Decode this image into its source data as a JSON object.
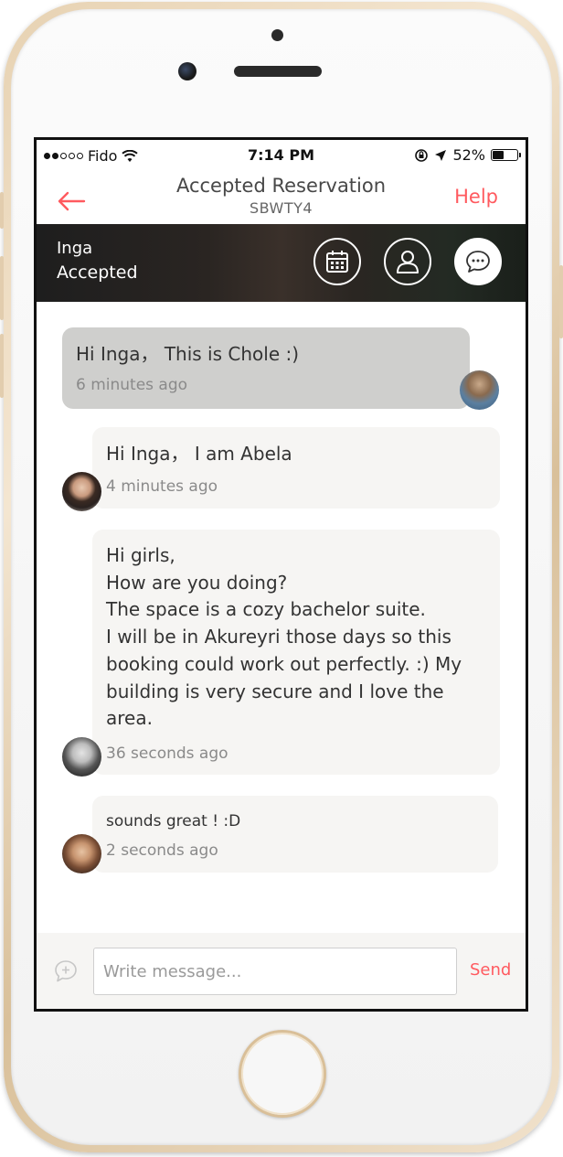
{
  "status_bar": {
    "carrier": "Fido",
    "time": "7:14 PM",
    "battery": "52%",
    "battery_level": 0.52,
    "signal_bars": 2,
    "icons": [
      "signal-dots-icon",
      "wifi-icon",
      "orientation-lock-icon",
      "location-arrow-icon",
      "battery-icon"
    ]
  },
  "header": {
    "back_icon": "arrow-left-icon",
    "title": "Accepted Reservation",
    "subtitle": "SBWTY4",
    "help_label": "Help"
  },
  "banner": {
    "name": "Inga",
    "status": "Accepted",
    "buttons": [
      {
        "icon": "calendar-icon"
      },
      {
        "icon": "person-icon"
      },
      {
        "icon": "chat-bubble-icon",
        "active": true
      }
    ]
  },
  "messages": [
    {
      "text": "Hi Inga， This is Chole :)",
      "time": "6 minutes ago",
      "own": true
    },
    {
      "text": "Hi Inga， I am Abela",
      "time": "4 minutes ago",
      "own": false
    },
    {
      "text": "Hi girls,\nHow are you doing?\nThe space is a cozy  bachelor  suite.\nI will be in Akureyri  those days so this\nbooking could work out perfectly. :) My\nbuilding is very secure and I love the\narea.",
      "time": "36 seconds ago",
      "own": false
    },
    {
      "text": "sounds great ! :D",
      "time": "2 seconds ago",
      "own": false
    }
  ],
  "compose": {
    "icon": "add-comment-icon",
    "placeholder": "Write message...",
    "value": "",
    "send_label": "Send"
  },
  "colors": {
    "accent": "#ff5a5f",
    "own_bubble": "#cfcfcd",
    "other_bubble": "#f6f5f3"
  }
}
